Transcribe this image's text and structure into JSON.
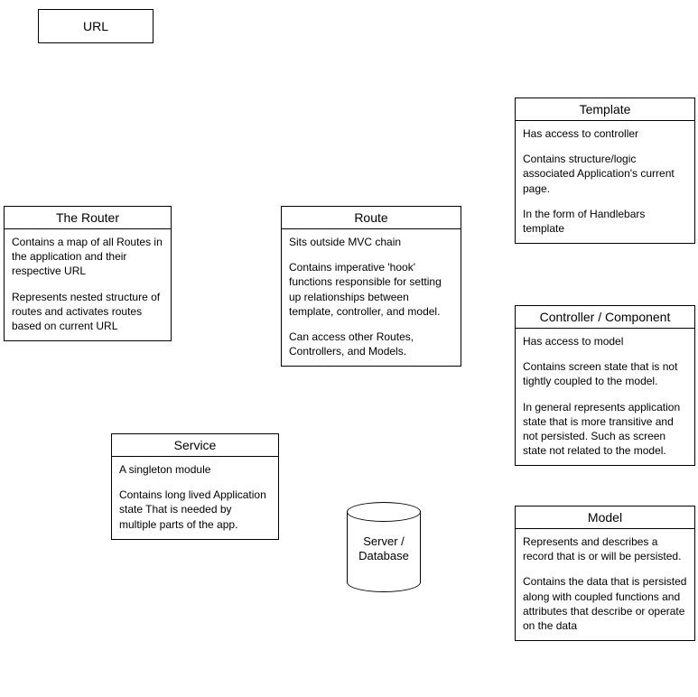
{
  "url_box": {
    "label": "URL"
  },
  "router": {
    "title": "The Router",
    "p1": "Contains a map of all Routes in the application and their respective URL",
    "p2": "Represents nested structure of routes and activates routes based on current URL"
  },
  "route": {
    "title": "Route",
    "p1": "Sits outside MVC chain",
    "p2": "Contains imperative 'hook' functions responsible for setting up relationships between template, controller, and model.",
    "p3": "Can access other Routes, Controllers, and Models."
  },
  "template": {
    "title": "Template",
    "p1": "Has access to controller",
    "p2": "Contains structure/logic associated Application's current page.",
    "p3": "In the form of Handlebars template"
  },
  "controller": {
    "title": "Controller / Component",
    "p1": "Has access to model",
    "p2": "Contains screen state that is not tightly coupled to the model.",
    "p3": "In general represents application state that is more transitive and not persisted. Such as screen state not related to the model."
  },
  "model": {
    "title": "Model",
    "p1": "Represents and describes a record that is or will be persisted.",
    "p2": "Contains the data that is persisted along with coupled functions and attributes that describe or operate on the data"
  },
  "service": {
    "title": "Service",
    "p1": "A singleton module",
    "p2": "Contains long lived Application state That is needed by multiple parts of the app."
  },
  "database": {
    "label_line1": "Server /",
    "label_line2": "Database"
  }
}
